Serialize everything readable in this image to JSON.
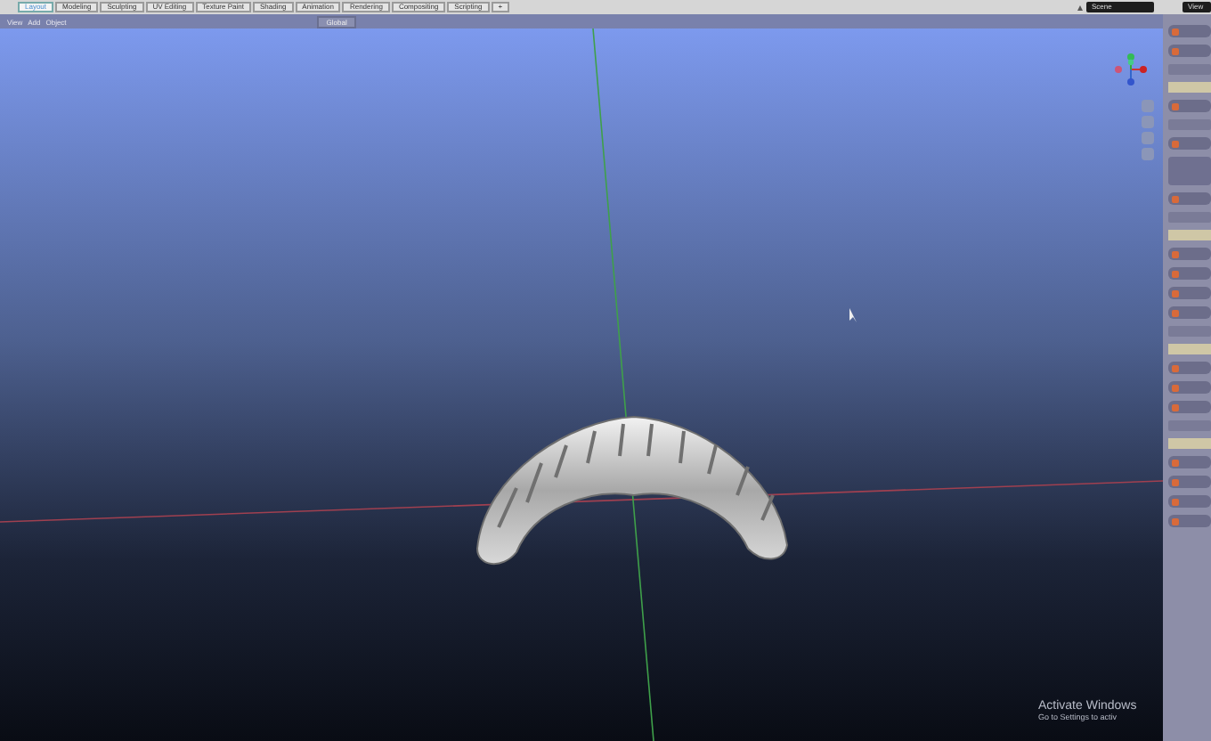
{
  "workspace_tabs": [
    {
      "label": "Layout",
      "selected": true
    },
    {
      "label": "Modeling",
      "selected": false
    },
    {
      "label": "Sculpting",
      "selected": false
    },
    {
      "label": "UV Editing",
      "selected": false
    },
    {
      "label": "Texture Paint",
      "selected": false
    },
    {
      "label": "Shading",
      "selected": false
    },
    {
      "label": "Animation",
      "selected": false
    },
    {
      "label": "Rendering",
      "selected": false
    },
    {
      "label": "Compositing",
      "selected": false
    },
    {
      "label": "Scripting",
      "selected": false
    }
  ],
  "add_tab": "+",
  "scene_field": {
    "value": "Scene"
  },
  "view_layer_field": {
    "value": "View"
  },
  "viewport_menu": [
    "View",
    "Add",
    "Object"
  ],
  "orientation_dropdown": {
    "value": "Global"
  },
  "side_panel": [
    {
      "kind": "button"
    },
    {
      "kind": "button"
    },
    {
      "kind": "row"
    },
    {
      "kind": "header"
    },
    {
      "kind": "button"
    },
    {
      "kind": "row"
    },
    {
      "kind": "button"
    },
    {
      "kind": "list"
    },
    {
      "kind": "button"
    },
    {
      "kind": "row"
    },
    {
      "kind": "header"
    },
    {
      "kind": "button"
    },
    {
      "kind": "button"
    },
    {
      "kind": "button"
    },
    {
      "kind": "button"
    },
    {
      "kind": "row"
    },
    {
      "kind": "header"
    },
    {
      "kind": "button"
    },
    {
      "kind": "button"
    },
    {
      "kind": "button"
    },
    {
      "kind": "row"
    },
    {
      "kind": "header"
    },
    {
      "kind": "button"
    },
    {
      "kind": "button"
    },
    {
      "kind": "button"
    },
    {
      "kind": "button"
    }
  ],
  "os_notice": {
    "title": "Activate Windows",
    "subtitle": "Go to Settings to activ"
  }
}
